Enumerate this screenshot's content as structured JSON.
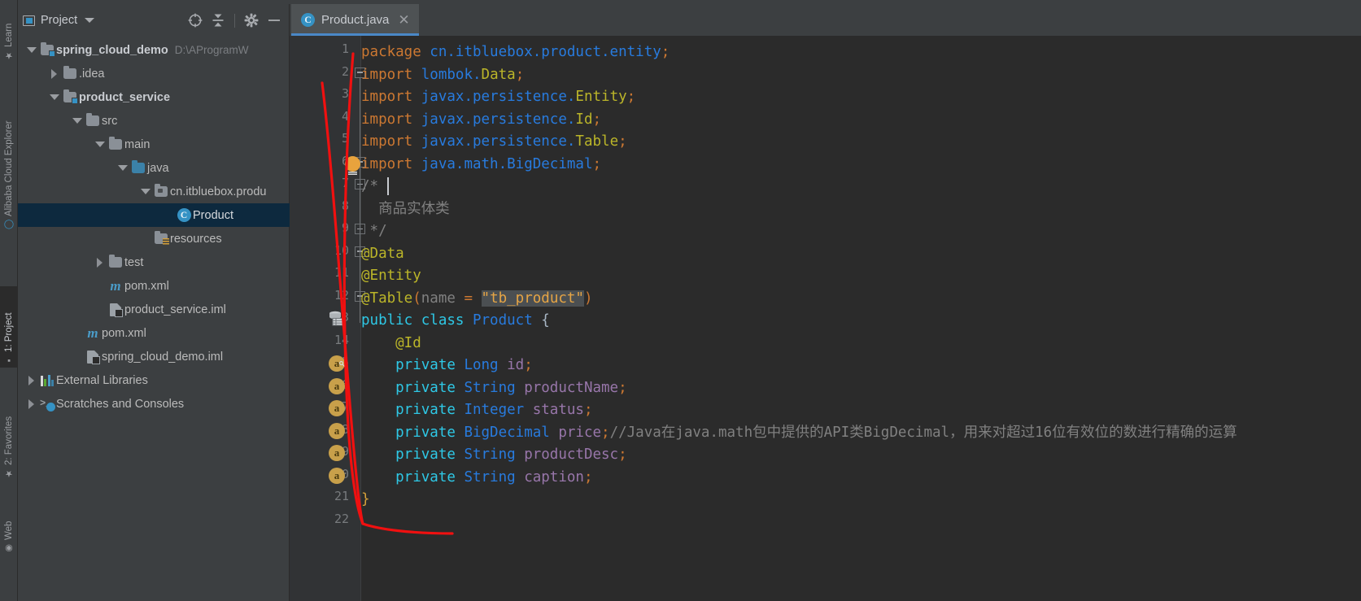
{
  "rail": {
    "items": [
      {
        "label": "Learn",
        "icon": "graduation-cap-icon",
        "active": false
      },
      {
        "label": "Alibaba Cloud Explorer",
        "icon": "cloud-explorer-icon",
        "active": false
      },
      {
        "label": "1: Project",
        "icon": "project-folder-icon",
        "active": true
      },
      {
        "label": "2: Favorites",
        "icon": "star-icon",
        "active": false
      },
      {
        "label": "Web",
        "icon": "web-globe-icon",
        "active": false
      }
    ]
  },
  "project_panel": {
    "title": "Project",
    "dropdown_icon": "chevron-down-icon",
    "toolbar": [
      {
        "name": "locate-icon",
        "label": "Select Opened File"
      },
      {
        "name": "collapse-all-icon",
        "label": "Collapse All"
      },
      {
        "name": "gear-icon",
        "label": "Settings"
      },
      {
        "name": "hide-icon",
        "label": "Hide"
      }
    ],
    "tree": [
      {
        "label": "spring_cloud_demo",
        "path": "D:\\AProgramW",
        "indent": 0,
        "arrow": "down",
        "icon": "module-folder-icon",
        "bold": true,
        "selected": false
      },
      {
        "label": ".idea",
        "path": "",
        "indent": 1,
        "arrow": "right",
        "icon": "folder-icon",
        "bold": false,
        "selected": false
      },
      {
        "label": "product_service",
        "path": "",
        "indent": 1,
        "arrow": "down",
        "icon": "module-folder-icon",
        "bold": true,
        "selected": false
      },
      {
        "label": "src",
        "path": "",
        "indent": 2,
        "arrow": "down",
        "icon": "folder-icon",
        "bold": false,
        "selected": false
      },
      {
        "label": "main",
        "path": "",
        "indent": 3,
        "arrow": "down",
        "icon": "folder-icon",
        "bold": false,
        "selected": false
      },
      {
        "label": "java",
        "path": "",
        "indent": 4,
        "arrow": "down",
        "icon": "source-folder-icon",
        "bold": false,
        "selected": false
      },
      {
        "label": "cn.itbluebox.produ",
        "path": "",
        "indent": 5,
        "arrow": "down",
        "icon": "package-folder-icon",
        "bold": false,
        "selected": false
      },
      {
        "label": "Product",
        "path": "",
        "indent": 6,
        "arrow": "none",
        "icon": "java-class-icon",
        "bold": false,
        "selected": true
      },
      {
        "label": "resources",
        "path": "",
        "indent": 5,
        "arrow": "none",
        "icon": "resources-folder-icon",
        "bold": false,
        "selected": false
      },
      {
        "label": "test",
        "path": "",
        "indent": 3,
        "arrow": "right",
        "icon": "folder-icon",
        "bold": false,
        "selected": false
      },
      {
        "label": "pom.xml",
        "path": "",
        "indent": 3,
        "arrow": "none",
        "icon": "maven-icon",
        "bold": false,
        "selected": false
      },
      {
        "label": "product_service.iml",
        "path": "",
        "indent": 3,
        "arrow": "none",
        "icon": "iml-file-icon",
        "bold": false,
        "selected": false
      },
      {
        "label": "pom.xml",
        "path": "",
        "indent": 2,
        "arrow": "none",
        "icon": "maven-icon",
        "bold": false,
        "selected": false
      },
      {
        "label": "spring_cloud_demo.iml",
        "path": "",
        "indent": 2,
        "arrow": "none",
        "icon": "iml-file-icon",
        "bold": false,
        "selected": false
      },
      {
        "label": "External Libraries",
        "path": "",
        "indent": 0,
        "arrow": "right",
        "icon": "libraries-icon",
        "bold": false,
        "selected": false
      },
      {
        "label": "Scratches and Consoles",
        "path": "",
        "indent": 0,
        "arrow": "right",
        "icon": "scratches-icon",
        "bold": false,
        "selected": false
      }
    ]
  },
  "editor": {
    "tab": {
      "label": "Product.java",
      "icon": "java-class-icon",
      "close_icon": "close-icon"
    },
    "total_lines": 22,
    "lines": [
      {
        "n": 1,
        "tokens": [
          {
            "t": "package ",
            "c": "kw"
          },
          {
            "t": "cn.itbluebox.product.entity",
            "c": "pkg"
          },
          {
            "t": ";",
            "c": "punc"
          }
        ]
      },
      {
        "n": 2,
        "tokens": [
          {
            "t": "import ",
            "c": "kw"
          },
          {
            "t": "lombok.",
            "c": "pkg"
          },
          {
            "t": "Data",
            "c": "ann"
          },
          {
            "t": ";",
            "c": "punc"
          }
        ]
      },
      {
        "n": 3,
        "tokens": [
          {
            "t": "import ",
            "c": "kw"
          },
          {
            "t": "javax.persistence.",
            "c": "pkg"
          },
          {
            "t": "Entity",
            "c": "ann"
          },
          {
            "t": ";",
            "c": "punc"
          }
        ]
      },
      {
        "n": 4,
        "tokens": [
          {
            "t": "import ",
            "c": "kw"
          },
          {
            "t": "javax.persistence.",
            "c": "pkg"
          },
          {
            "t": "Id",
            "c": "ann"
          },
          {
            "t": ";",
            "c": "punc"
          }
        ]
      },
      {
        "n": 5,
        "tokens": [
          {
            "t": "import ",
            "c": "kw"
          },
          {
            "t": "javax.persistence.",
            "c": "pkg"
          },
          {
            "t": "Table",
            "c": "ann"
          },
          {
            "t": ";",
            "c": "punc"
          }
        ]
      },
      {
        "n": 6,
        "tokens": [
          {
            "t": "import ",
            "c": "kw"
          },
          {
            "t": "java.math.",
            "c": "pkg"
          },
          {
            "t": "BigDecimal",
            "c": "pkg"
          },
          {
            "t": ";",
            "c": "punc"
          }
        ]
      },
      {
        "n": 7,
        "tokens": [
          {
            "t": "/*",
            "c": "cmt"
          }
        ]
      },
      {
        "n": 8,
        "tokens": [
          {
            "t": "  商品实体类",
            "c": "cmt"
          }
        ]
      },
      {
        "n": 9,
        "tokens": [
          {
            "t": " */",
            "c": "cmt"
          }
        ]
      },
      {
        "n": 10,
        "tokens": [
          {
            "t": "@Data",
            "c": "ann"
          }
        ]
      },
      {
        "n": 11,
        "tokens": [
          {
            "t": "@Entity",
            "c": "ann"
          }
        ]
      },
      {
        "n": 12,
        "tokens": [
          {
            "t": "@Table",
            "c": "ann"
          },
          {
            "t": "(",
            "c": "punc"
          },
          {
            "t": "name",
            "c": "cmt2"
          },
          {
            "t": " = ",
            "c": "punc"
          },
          {
            "t": "\"tb_product\"",
            "c": "str-hl-tok"
          },
          {
            "t": ")",
            "c": "punc"
          }
        ]
      },
      {
        "n": 13,
        "tokens": [
          {
            "t": "public ",
            "c": "kw2"
          },
          {
            "t": "class ",
            "c": "kw2"
          },
          {
            "t": "Product",
            "c": "cls"
          },
          {
            "t": " {",
            "c": "plain"
          }
        ]
      },
      {
        "n": 14,
        "tokens": [
          {
            "t": "    @Id",
            "c": "ann"
          }
        ]
      },
      {
        "n": 15,
        "tokens": [
          {
            "t": "    private ",
            "c": "kw2"
          },
          {
            "t": "Long",
            "c": "cls"
          },
          {
            "t": " id",
            "c": "fld2"
          },
          {
            "t": ";",
            "c": "punc"
          }
        ]
      },
      {
        "n": 16,
        "tokens": [
          {
            "t": "    private ",
            "c": "kw2"
          },
          {
            "t": "String",
            "c": "cls"
          },
          {
            "t": " productName",
            "c": "fld2"
          },
          {
            "t": ";",
            "c": "punc"
          }
        ]
      },
      {
        "n": 17,
        "tokens": [
          {
            "t": "    private ",
            "c": "kw2"
          },
          {
            "t": "Integer",
            "c": "cls"
          },
          {
            "t": " status",
            "c": "fld2"
          },
          {
            "t": ";",
            "c": "punc"
          }
        ]
      },
      {
        "n": 18,
        "tokens": [
          {
            "t": "    private ",
            "c": "kw2"
          },
          {
            "t": "BigDecimal",
            "c": "cls"
          },
          {
            "t": " price",
            "c": "fld2"
          },
          {
            "t": ";",
            "c": "punc"
          },
          {
            "t": "//Java在java.math包中提供的API类BigDecimal，用来对超过16位有效位的数进行精确的运算",
            "c": "cmt"
          }
        ]
      },
      {
        "n": 19,
        "tokens": [
          {
            "t": "    private ",
            "c": "kw2"
          },
          {
            "t": "String",
            "c": "cls"
          },
          {
            "t": " productDesc",
            "c": "fld2"
          },
          {
            "t": ";",
            "c": "punc"
          }
        ]
      },
      {
        "n": 20,
        "tokens": [
          {
            "t": "    private ",
            "c": "kw2"
          },
          {
            "t": "String",
            "c": "cls"
          },
          {
            "t": " caption",
            "c": "fld2"
          },
          {
            "t": ";",
            "c": "punc"
          }
        ]
      },
      {
        "n": 21,
        "tokens": [
          {
            "t": "}",
            "c": "brc"
          }
        ]
      },
      {
        "n": 22,
        "tokens": []
      }
    ],
    "gutter_marks": [
      {
        "line": 15,
        "type": "lombok-accessor-icon",
        "glyph": "a",
        "has_key": true
      },
      {
        "line": 16,
        "type": "lombok-accessor-icon",
        "glyph": "a",
        "has_key": false
      },
      {
        "line": 17,
        "type": "lombok-accessor-icon",
        "glyph": "a",
        "has_key": false
      },
      {
        "line": 18,
        "type": "lombok-accessor-icon",
        "glyph": "a",
        "has_key": false
      },
      {
        "line": 19,
        "type": "lombok-accessor-icon",
        "glyph": "a",
        "has_key": false
      },
      {
        "line": 20,
        "type": "lombok-accessor-icon",
        "glyph": "a",
        "has_key": false
      },
      {
        "line": 13,
        "type": "database-table-icon",
        "glyph": "",
        "has_key": false
      }
    ],
    "intention_bulb": {
      "line": 6,
      "icon": "lightbulb-icon"
    },
    "caret": {
      "line": 7,
      "column": 3
    }
  },
  "annotation": {
    "color": "#f01010",
    "shape": "red-arrow"
  },
  "colors": {
    "accent": "#3592c4",
    "selection": "#0d293e",
    "editor_bg": "#2b2b2b",
    "panel_bg": "#3c3f41",
    "gutter_bg": "#313335",
    "tab_underline": "#4a88c7"
  }
}
